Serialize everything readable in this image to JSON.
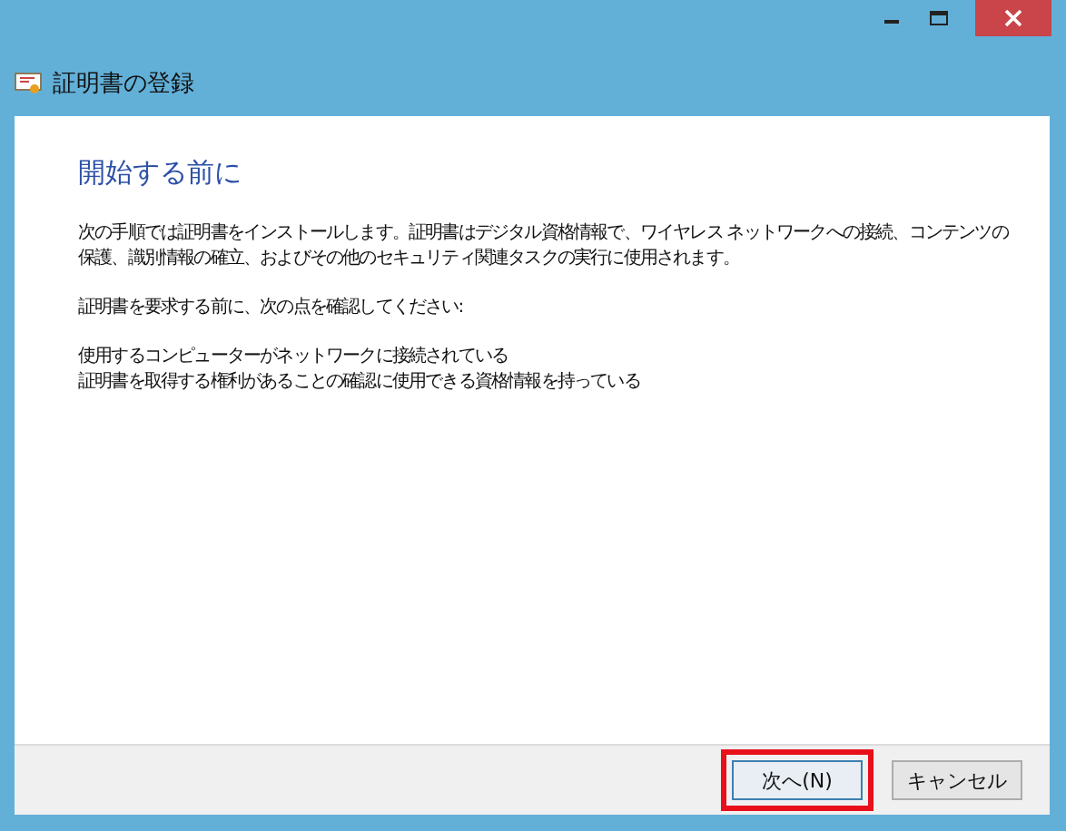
{
  "window": {
    "title": "証明書の登録"
  },
  "heading": "開始する前に",
  "paragraphs": [
    [
      "次の手順では証明書をインストールします。証明書はデジタル資格情報で、ワイヤレス ネットワークへの接続、コンテンツの",
      "保護、識別情報の確立、およびその他のセキュリティ関連タスクの実行に使用されます。"
    ],
    [
      "証明書を要求する前に、次の点を確認してください:"
    ],
    [
      "使用するコンピューターがネットワークに接続されている",
      "証明書を取得する権利があることの確認に使用できる資格情報を持っている"
    ]
  ],
  "buttons": [
    {
      "label": "次へ(N)",
      "highlighted": true,
      "kind": "default"
    },
    {
      "label": "キャンセル",
      "highlighted": false,
      "kind": "normal"
    }
  ]
}
